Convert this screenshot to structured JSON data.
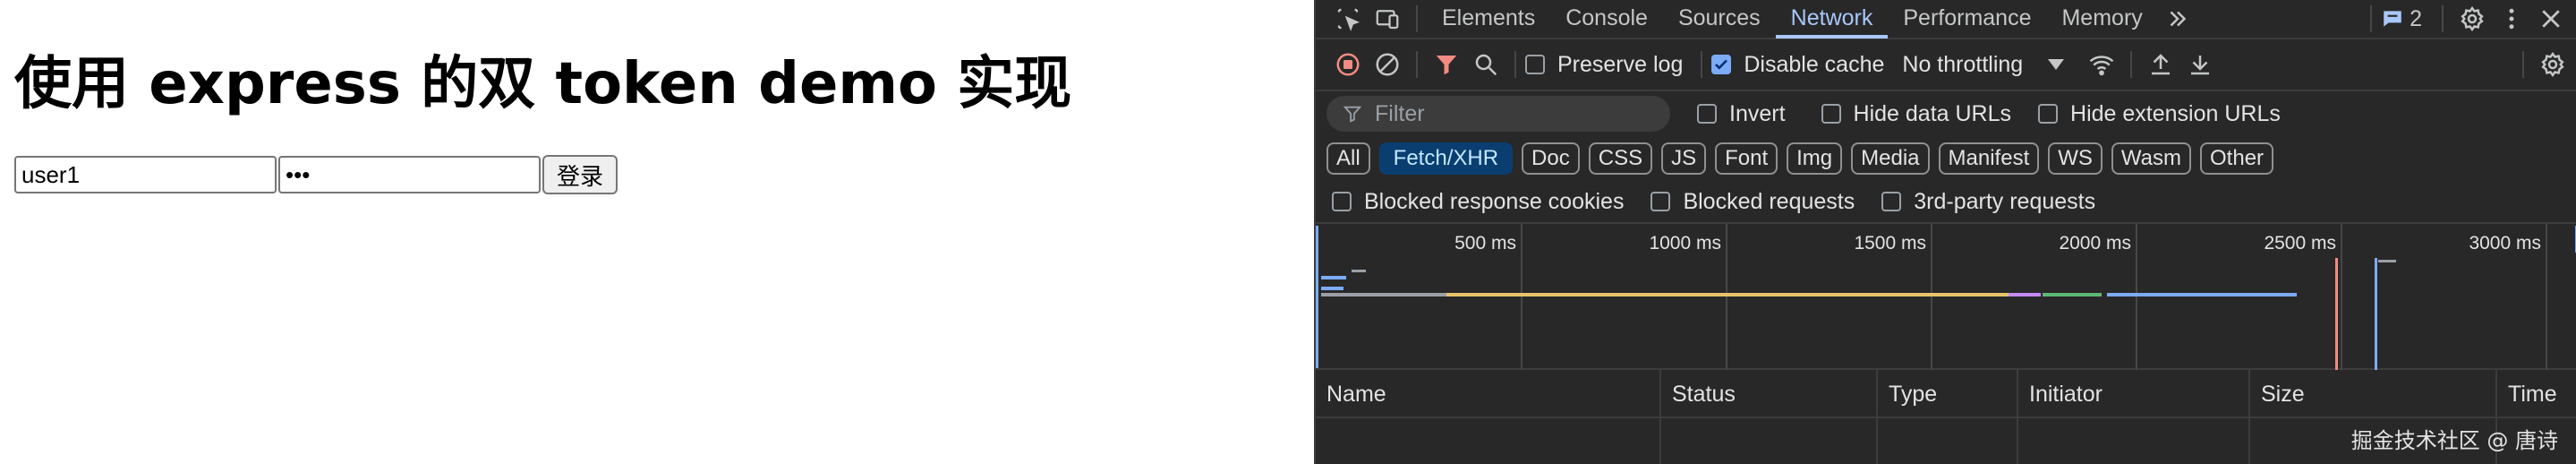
{
  "page": {
    "title": "使用 express 的双 token demo 实现",
    "username_value": "user1",
    "password_value": "•••",
    "login_button": "登录"
  },
  "devtools": {
    "tabs": [
      "Elements",
      "Console",
      "Sources",
      "Network",
      "Performance",
      "Memory"
    ],
    "active_tab": "Network",
    "issues_count": "2",
    "toolbar": {
      "preserve_log": "Preserve log",
      "preserve_log_checked": false,
      "disable_cache": "Disable cache",
      "disable_cache_checked": true,
      "throttling": "No throttling"
    },
    "filter": {
      "placeholder": "Filter",
      "invert": "Invert",
      "hide_data_urls": "Hide data URLs",
      "hide_extension_urls": "Hide extension URLs"
    },
    "type_chips": [
      "All",
      "Fetch/XHR",
      "Doc",
      "CSS",
      "JS",
      "Font",
      "Img",
      "Media",
      "Manifest",
      "WS",
      "Wasm",
      "Other"
    ],
    "active_chip": "Fetch/XHR",
    "blocked": {
      "blocked_cookies": "Blocked response cookies",
      "blocked_requests": "Blocked requests",
      "third_party": "3rd-party requests"
    },
    "timeline_ticks": [
      "500 ms",
      "1000 ms",
      "1500 ms",
      "2000 ms",
      "2500 ms",
      "3000 ms"
    ],
    "columns": [
      "Name",
      "Status",
      "Type",
      "Initiator",
      "Size",
      "Time"
    ],
    "accent": "#a8c7fa",
    "background": "#282828"
  },
  "watermark": "掘金技术社区 @ 唐诗"
}
